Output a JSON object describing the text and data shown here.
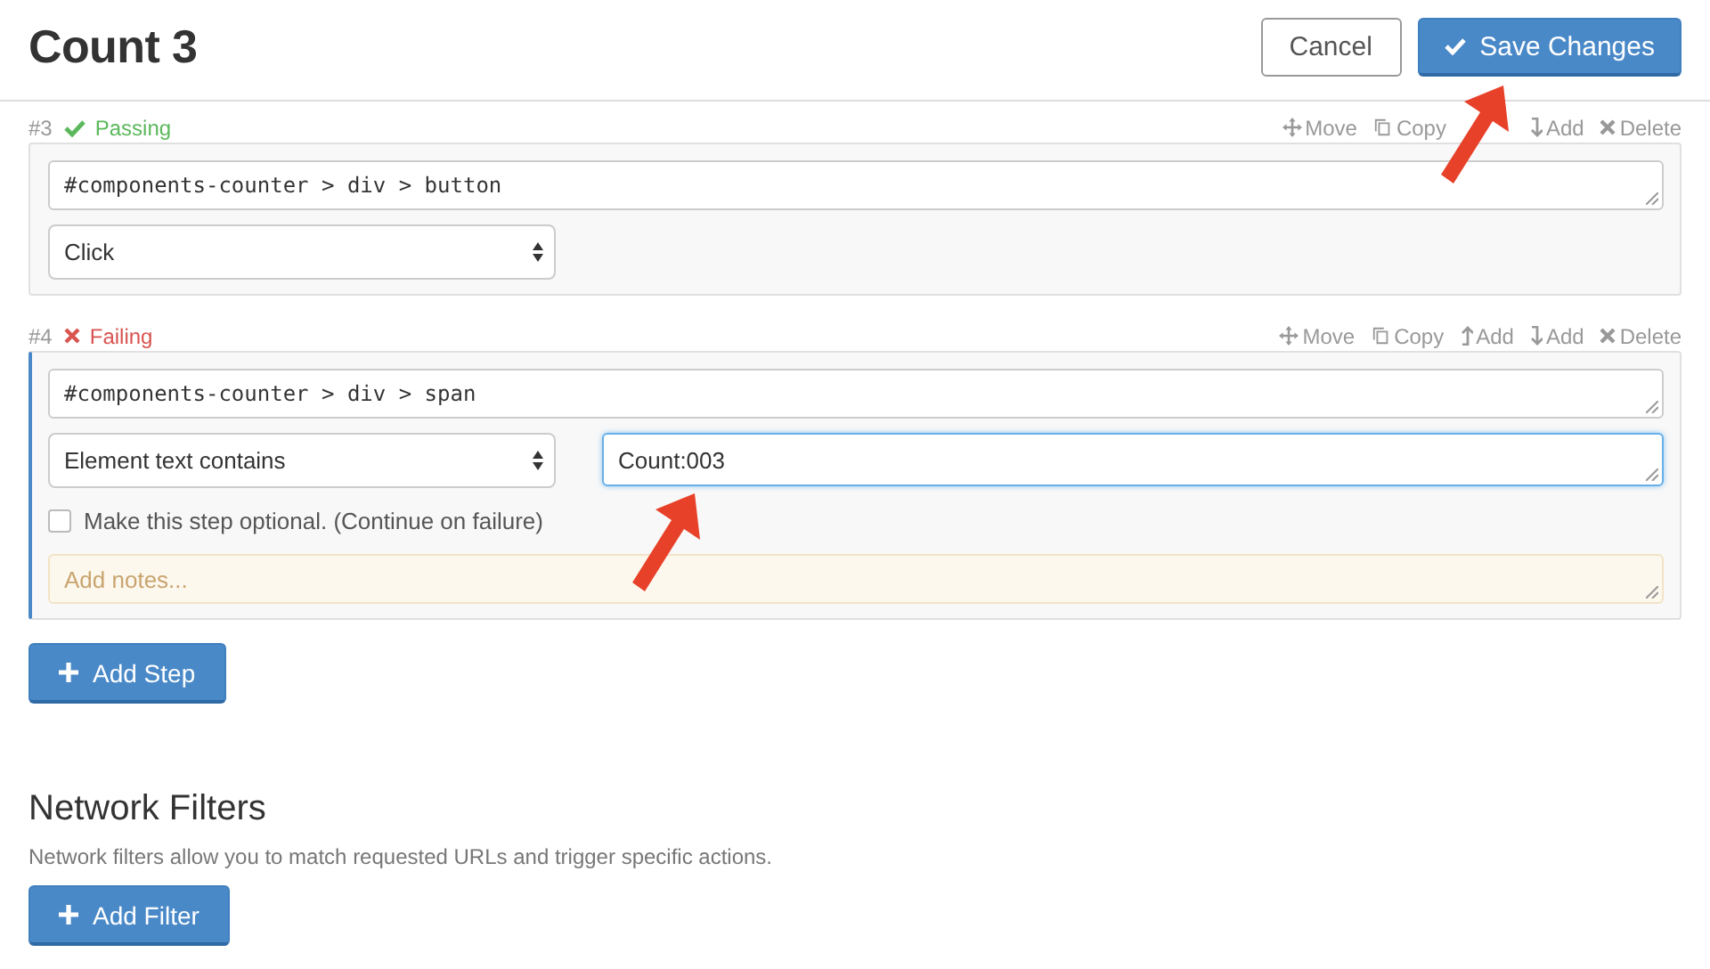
{
  "header": {
    "title": "Count 3",
    "buttons": [
      {
        "kind": "secondary",
        "label": "Cancel",
        "annotated": false
      },
      {
        "kind": "primary",
        "label": "Save Changes",
        "annotated": true
      }
    ]
  },
  "steps": [
    {
      "number": "#3",
      "kind": "passing",
      "status_label": "Passing",
      "active": false,
      "actions": [
        {
          "kind": "move",
          "label": "Move"
        },
        {
          "kind": "copy",
          "label": "Copy"
        },
        {
          "kind": "down",
          "label": "Add"
        },
        {
          "kind": "delete",
          "label": "Delete"
        }
      ],
      "selector": "#components-counter > div > button",
      "action": "Click"
    },
    {
      "number": "#4",
      "kind": "failing",
      "status_label": "Failing",
      "active": true,
      "actions": [
        {
          "kind": "move",
          "label": "Move"
        },
        {
          "kind": "copy",
          "label": "Copy"
        },
        {
          "kind": "up",
          "label": "Add"
        },
        {
          "kind": "down",
          "label": "Add"
        },
        {
          "kind": "delete",
          "label": "Delete"
        }
      ],
      "selector": "#components-counter > div > span",
      "action": "Element text contains",
      "value": {
        "text": "Count:003",
        "focused": true,
        "annotated": true
      },
      "optional": {
        "label": "Make this step optional. (Continue on failure)",
        "checked": false
      },
      "notes": {
        "placeholder": "Add notes..."
      }
    }
  ],
  "add_step": {
    "label": "Add Step"
  },
  "network_filters": {
    "title": "Network Filters",
    "description": "Network filters allow you to match requested URLs and trigger specific actions.",
    "button": {
      "label": "Add Filter"
    }
  }
}
